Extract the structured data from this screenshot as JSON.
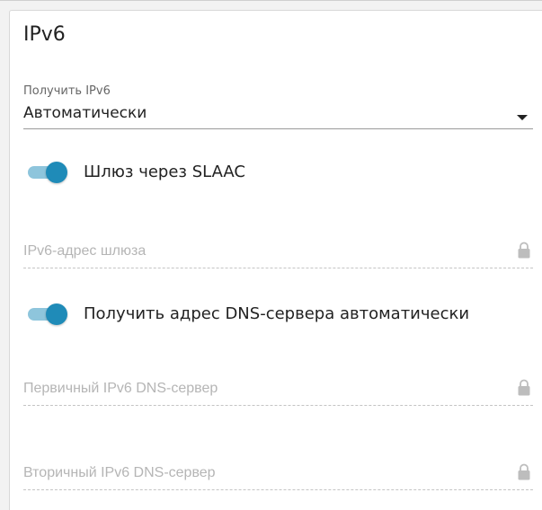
{
  "ipv6": {
    "title": "IPv6",
    "obtain": {
      "label": "Получить IPv6",
      "value": "Автоматически"
    },
    "slaac_gateway": {
      "label": "Шлюз через SLAAC",
      "enabled": true
    },
    "gateway_address": {
      "placeholder": "IPv6-адрес шлюза",
      "icon": "lock-icon"
    },
    "dns_auto": {
      "label": "Получить адрес DNS-сервера автоматически",
      "enabled": true
    },
    "primary_dns": {
      "placeholder": "Первичный IPv6 DNS-сервер",
      "icon": "lock-icon"
    },
    "secondary_dns": {
      "placeholder": "Вторичный IPv6 DNS-сервер",
      "icon": "lock-icon"
    }
  },
  "colors": {
    "accent": "#1f8bb8",
    "accent_light": "#8ec5dc",
    "disabled_text": "#b5b5b5"
  }
}
